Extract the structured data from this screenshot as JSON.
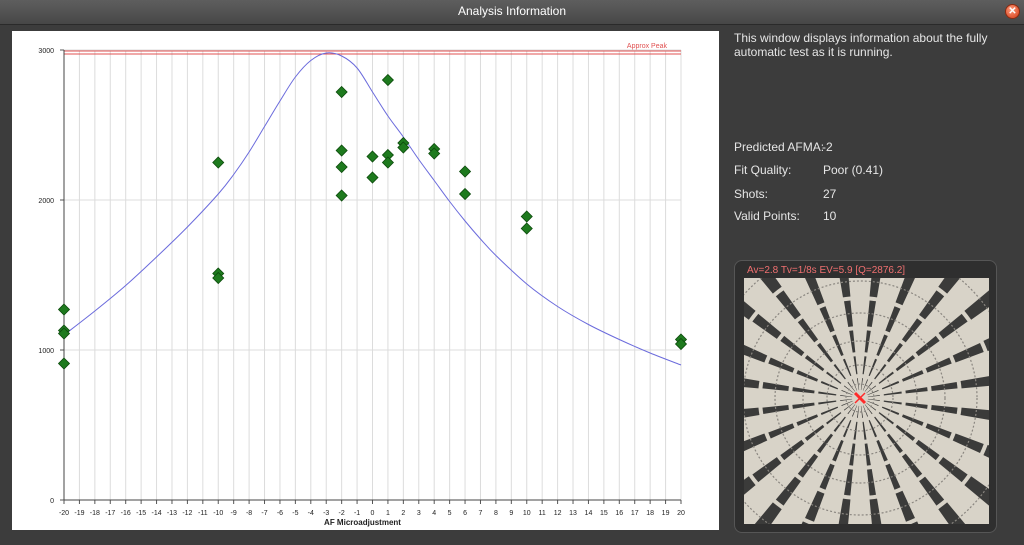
{
  "window": {
    "title": "Analysis Information",
    "close_icon": "close-icon"
  },
  "description": "This window displays information about the fully automatic test as it is running.",
  "stats": {
    "predicted_afma_label": "Predicted AFMA:",
    "predicted_afma_value": "-2",
    "fit_quality_label": "Fit Quality:",
    "fit_quality_value": "Poor (0.41)",
    "shots_label": "Shots:",
    "shots_value": "27",
    "valid_points_label": "Valid Points:",
    "valid_points_value": "10"
  },
  "thumbnail": {
    "caption": "Av=2.8  Tv=1/8s  EV=5.9 [Q=2876.2]",
    "marker_color": "#ff2a2a"
  },
  "chart_data": {
    "type": "scatter",
    "xlabel": "AF Microadjustment",
    "ylabel": "",
    "xlim": [
      -20,
      20
    ],
    "ylim": [
      0,
      3000
    ],
    "x_ticks": [
      -20,
      -19,
      -18,
      -17,
      -16,
      -15,
      -14,
      -13,
      -12,
      -11,
      -10,
      -9,
      -8,
      -7,
      -6,
      -5,
      -4,
      -3,
      -2,
      -1,
      0,
      1,
      2,
      3,
      4,
      5,
      6,
      7,
      8,
      9,
      10,
      11,
      12,
      13,
      14,
      15,
      16,
      17,
      18,
      19,
      20
    ],
    "y_ticks": [
      0,
      1000,
      2000,
      3000
    ],
    "grid": true,
    "reference_line": {
      "label": "Approx Peak",
      "y": 2980,
      "color": "#e05050"
    },
    "marker_color": "#1e7a1e",
    "fit_color": "#6b6bdc",
    "points": [
      {
        "x": -20,
        "y": 1270
      },
      {
        "x": -20,
        "y": 1130
      },
      {
        "x": -20,
        "y": 1110
      },
      {
        "x": -20,
        "y": 910
      },
      {
        "x": -10,
        "y": 2250
      },
      {
        "x": -10,
        "y": 1510
      },
      {
        "x": -10,
        "y": 1480
      },
      {
        "x": -2,
        "y": 2720
      },
      {
        "x": -2,
        "y": 2330
      },
      {
        "x": -2,
        "y": 2220
      },
      {
        "x": -2,
        "y": 2030
      },
      {
        "x": 0,
        "y": 2290
      },
      {
        "x": 0,
        "y": 2150
      },
      {
        "x": 1,
        "y": 2800
      },
      {
        "x": 1,
        "y": 2300
      },
      {
        "x": 1,
        "y": 2250
      },
      {
        "x": 2,
        "y": 2380
      },
      {
        "x": 2,
        "y": 2350
      },
      {
        "x": 4,
        "y": 2340
      },
      {
        "x": 4,
        "y": 2310
      },
      {
        "x": 6,
        "y": 2190
      },
      {
        "x": 6,
        "y": 2040
      },
      {
        "x": 10,
        "y": 1890
      },
      {
        "x": 10,
        "y": 1810
      },
      {
        "x": 20,
        "y": 1070
      },
      {
        "x": 20,
        "y": 1040
      }
    ],
    "fit_curve": {
      "x": [
        -20,
        -18,
        -16,
        -14,
        -12,
        -10,
        -9,
        -8,
        -7,
        -6,
        -5,
        -4,
        -3,
        -2,
        -1,
        0,
        1,
        2,
        3,
        4,
        5,
        6,
        7,
        8,
        10,
        12,
        14,
        16,
        18,
        20
      ],
      "y": [
        1100,
        1260,
        1430,
        1620,
        1820,
        2040,
        2170,
        2320,
        2490,
        2660,
        2820,
        2930,
        2980,
        2960,
        2880,
        2720,
        2560,
        2420,
        2270,
        2130,
        1990,
        1860,
        1740,
        1630,
        1440,
        1290,
        1170,
        1070,
        980,
        900
      ]
    }
  }
}
